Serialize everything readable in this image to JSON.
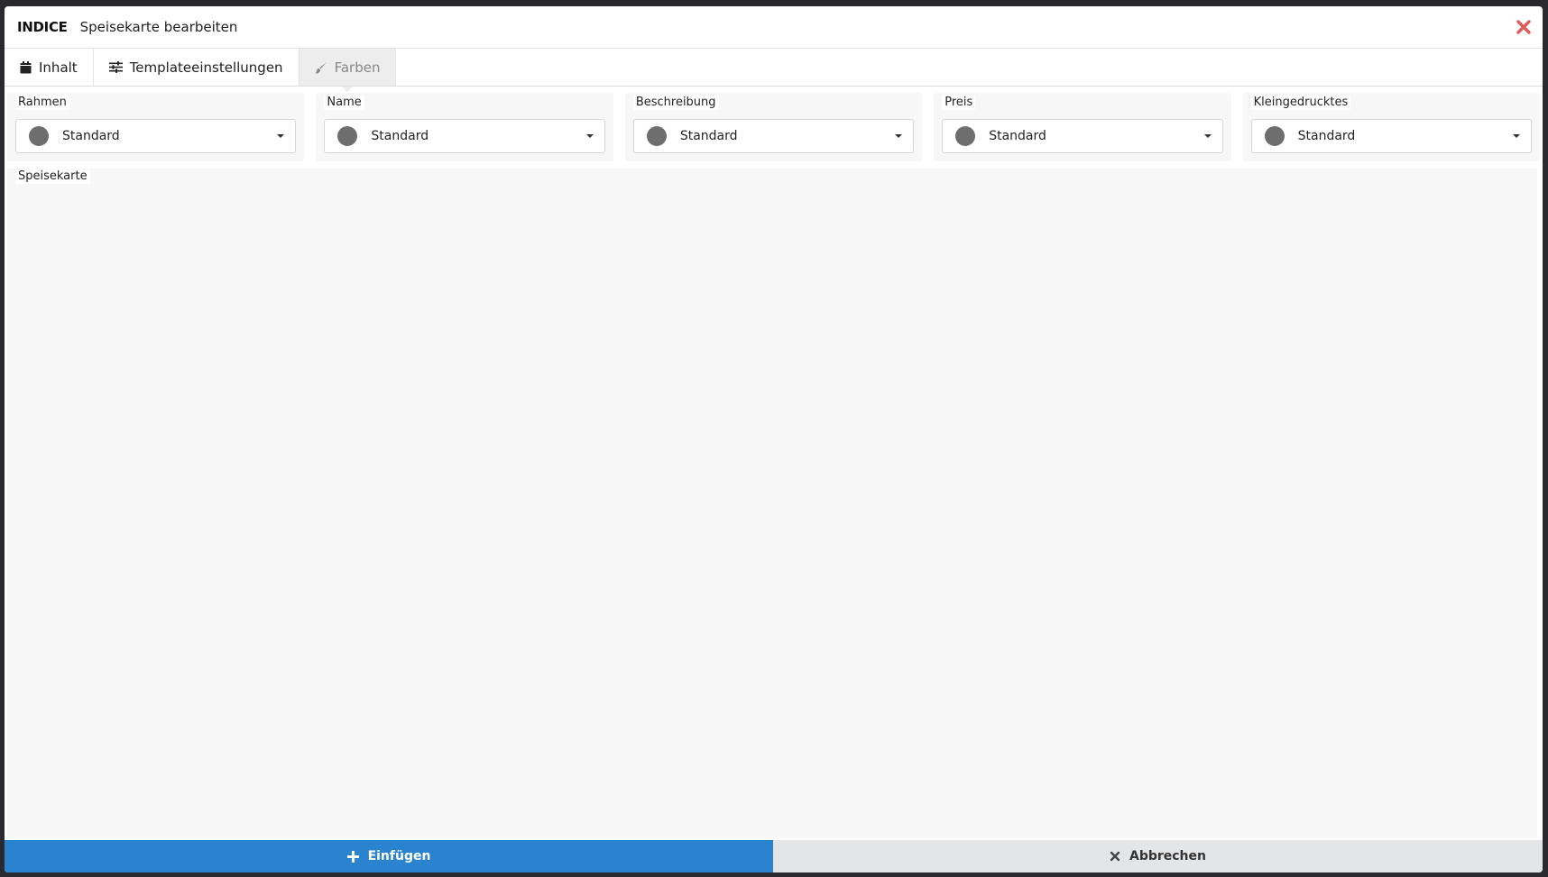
{
  "header": {
    "brand": "INDICE",
    "title": "Speisekarte bearbeiten",
    "close_icon": "close-icon",
    "close_color": "#e05a5a"
  },
  "tabs": [
    {
      "label": "Inhalt",
      "icon": "calendar-icon",
      "active": false
    },
    {
      "label": "Templateeinstellungen",
      "icon": "sliders-icon",
      "active": false
    },
    {
      "label": "Farben",
      "icon": "brush-icon",
      "active": true
    }
  ],
  "color_groups": [
    {
      "label": "Rahmen",
      "value": "Standard"
    },
    {
      "label": "Name",
      "value": "Standard"
    },
    {
      "label": "Beschreibung",
      "value": "Standard"
    },
    {
      "label": "Preis",
      "value": "Standard"
    },
    {
      "label": "Kleingedrucktes",
      "value": "Standard"
    }
  ],
  "menu_section": {
    "label": "Speisekarte"
  },
  "footer": {
    "insert_label": "Einfügen",
    "insert_icon": "plus-icon",
    "insert_color": "#2a83cf",
    "cancel_label": "Abbrechen",
    "cancel_icon": "x-icon"
  },
  "colors": {
    "swatch": "#6e6e6e",
    "panel_bg": "#f7f7f7"
  }
}
